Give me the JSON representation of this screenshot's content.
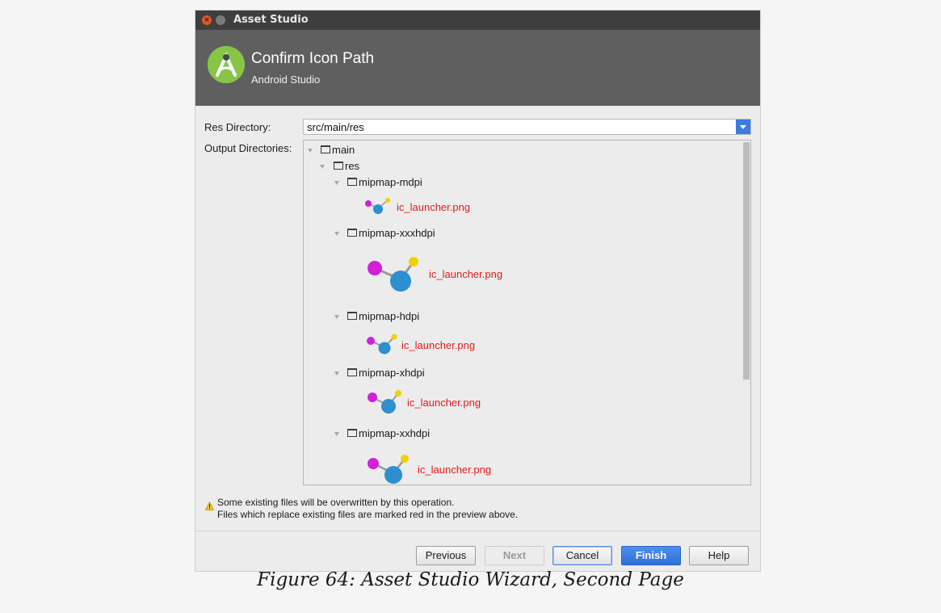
{
  "window": {
    "title": "Asset Studio",
    "close_glyph": "×"
  },
  "header": {
    "title": "Confirm Icon Path",
    "subtitle": "Android Studio"
  },
  "form": {
    "res_dir_label": "Res Directory:",
    "res_dir_value": "src/main/res",
    "output_label": "Output Directories:"
  },
  "tree": {
    "main": "main",
    "res": "res",
    "folders": [
      {
        "name": "mipmap-mdpi",
        "file": "ic_launcher.png"
      },
      {
        "name": "mipmap-xxxhdpi",
        "file": "ic_launcher.png"
      },
      {
        "name": "mipmap-hdpi",
        "file": "ic_launcher.png"
      },
      {
        "name": "mipmap-xhdpi",
        "file": "ic_launcher.png"
      },
      {
        "name": "mipmap-xxhdpi",
        "file": "ic_launcher.png"
      }
    ]
  },
  "warning": {
    "line1": "Some existing files will be overwritten by this operation.",
    "line2": "Files which replace existing files are marked red in the preview above."
  },
  "buttons": {
    "previous": "Previous",
    "next": "Next",
    "cancel": "Cancel",
    "finish": "Finish",
    "help": "Help"
  },
  "caption": "Figure 64: Asset Studio Wizard, Second Page",
  "colors": {
    "overwrite_text": "#e61919",
    "primary_button": "#3c7be0",
    "banner": "#5f5f5f"
  }
}
